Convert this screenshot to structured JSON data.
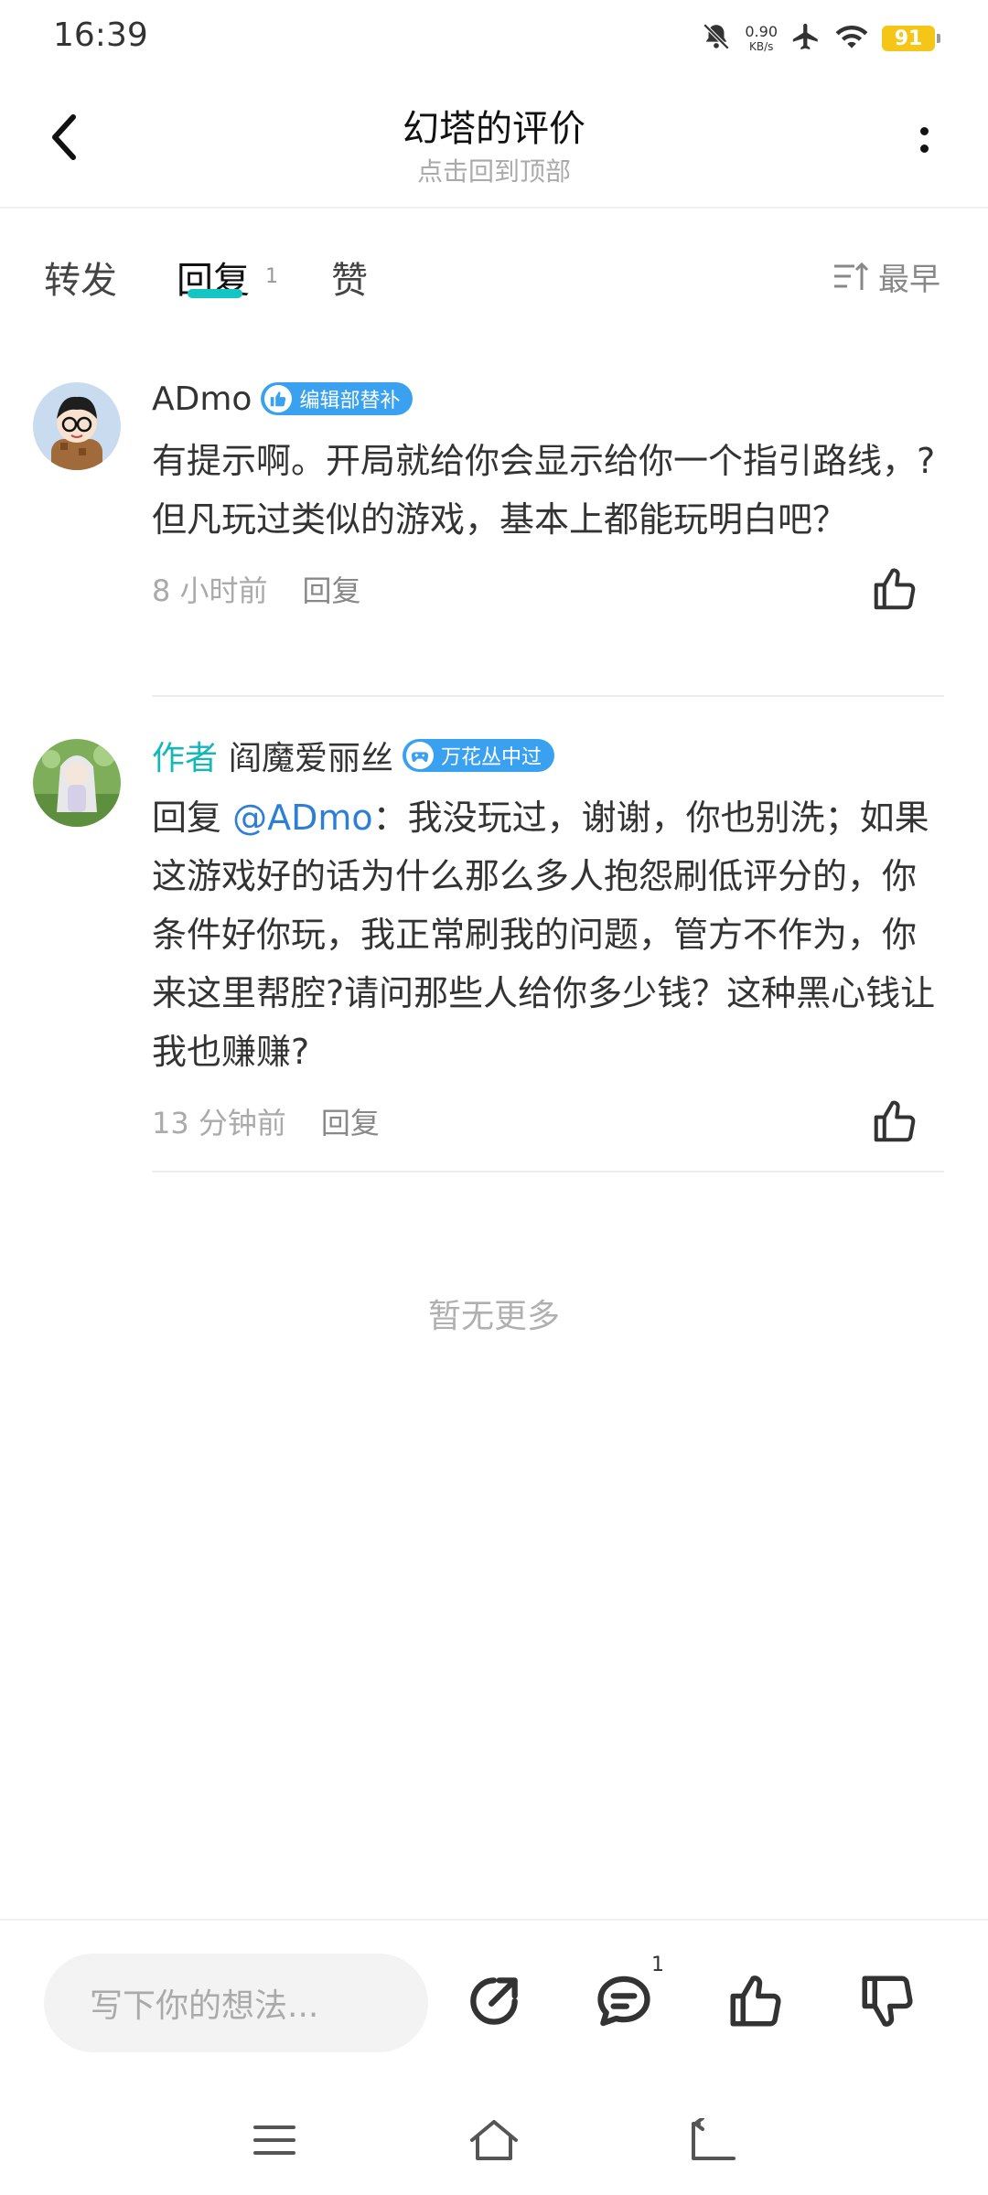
{
  "status": {
    "time": "16:39",
    "speed_value": "0.90",
    "speed_unit": "KB/s",
    "battery": "91",
    "icons": [
      "bell-muted-icon",
      "airplane-icon",
      "wifi-icon",
      "battery-icon"
    ]
  },
  "header": {
    "title": "幻塔的评价",
    "subtitle": "点击回到顶部"
  },
  "tabs": [
    {
      "label": "转发"
    },
    {
      "label": "回复",
      "count": "1",
      "active": true
    },
    {
      "label": "赞"
    }
  ],
  "sort_label": "最早",
  "comments": [
    {
      "username": "ADmo",
      "badge": "编辑部替补",
      "text": "有提示啊。开局就给你会显示给你一个指引路线，?但凡玩过类似的游戏，基本上都能玩明白吧？",
      "time": "8 小时前",
      "reply_label": "回复"
    },
    {
      "author_tag": "作者",
      "username": "阎魔爱丽丝",
      "badge": "万花丛中过",
      "reply_prefix": "回复 ",
      "mention": "@ADmo",
      "text": "：我没玩过，谢谢，你也别洗；如果这游戏好的话为什么那么多人抱怨刷低评分的，你条件好你玩，我正常刷我的问题，管方不作为，你来这里帮腔?请问那些人给你多少钱？这种黑心钱让我也赚赚?",
      "time": "13 分钟前",
      "reply_label": "回复"
    }
  ],
  "no_more": "暂无更多",
  "bottom": {
    "input_placeholder": "写下你的想法...",
    "comment_count": "1"
  },
  "colors": {
    "accent": "#14c5c5",
    "badge": "#3aa0f0",
    "mention": "#2d7fd6"
  }
}
